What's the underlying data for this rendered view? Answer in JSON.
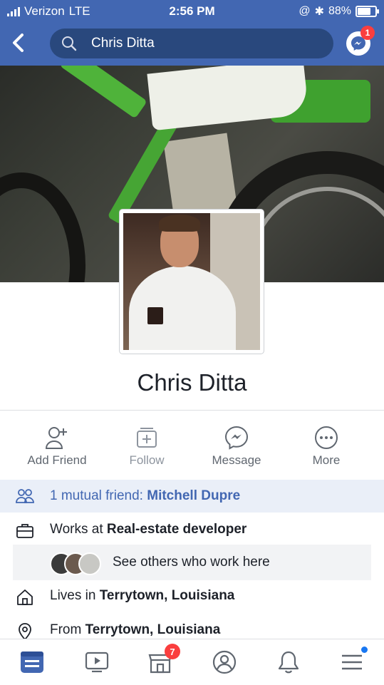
{
  "status": {
    "carrier": "Verizon",
    "network": "LTE",
    "time": "2:56 PM",
    "battery": "88%",
    "battery_level": 0.88
  },
  "nav": {
    "search_text": "Chris Ditta",
    "messenger_badge": "1"
  },
  "profile": {
    "name": "Chris Ditta"
  },
  "actions": [
    {
      "label": "Add Friend"
    },
    {
      "label": "Follow"
    },
    {
      "label": "Message"
    },
    {
      "label": "More"
    }
  ],
  "mutual": {
    "prefix": "1 mutual friend: ",
    "friend": "Mitchell Dupre"
  },
  "intro": {
    "work_prefix": "Works at ",
    "work": "Real-estate developer",
    "see_others": "See others who work here",
    "lives_prefix": "Lives in ",
    "lives": "Terrytown, Louisiana",
    "from_prefix": "From ",
    "from": "Terrytown, Louisiana"
  },
  "tabbar": {
    "notifications_badge": "7"
  },
  "colors": {
    "brand": "#4267b2",
    "badge": "#fa3e3e",
    "mutual_bg": "#eaeff8"
  }
}
